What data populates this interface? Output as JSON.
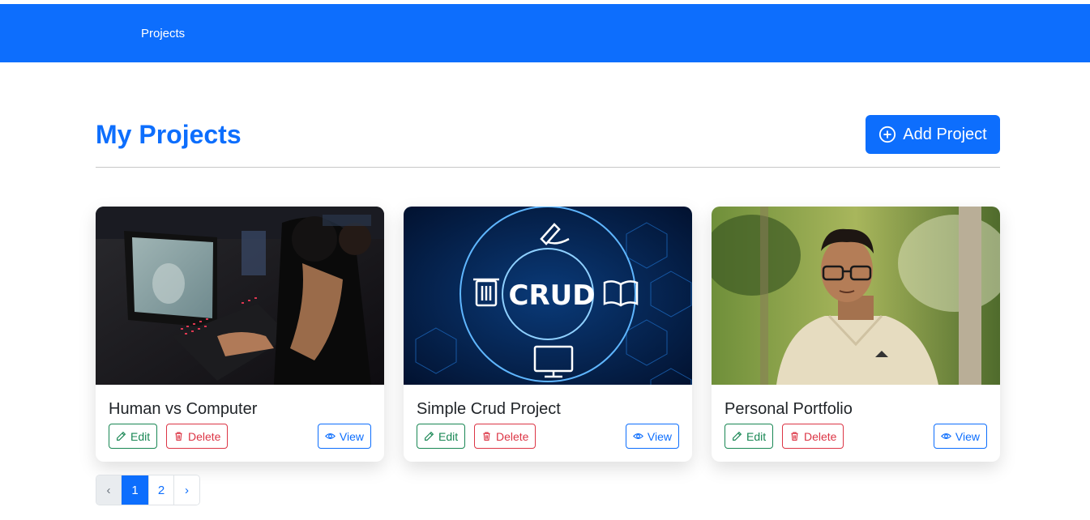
{
  "navbar": {
    "link": "Projects"
  },
  "header": {
    "title": "My Projects",
    "add_button": "Add Project"
  },
  "projects": [
    {
      "title": "Human vs Computer",
      "edit": "Edit",
      "delete": "Delete",
      "view": "View"
    },
    {
      "title": "Simple Crud Project",
      "edit": "Edit",
      "delete": "Delete",
      "view": "View",
      "image_text": "CRUD"
    },
    {
      "title": "Personal Portfolio",
      "edit": "Edit",
      "delete": "Delete",
      "view": "View"
    }
  ],
  "pagination": {
    "prev": "‹",
    "pages": [
      "1",
      "2"
    ],
    "next": "›",
    "active": "1"
  },
  "colors": {
    "primary": "#0d6efd",
    "success": "#198754",
    "danger": "#dc3545"
  }
}
